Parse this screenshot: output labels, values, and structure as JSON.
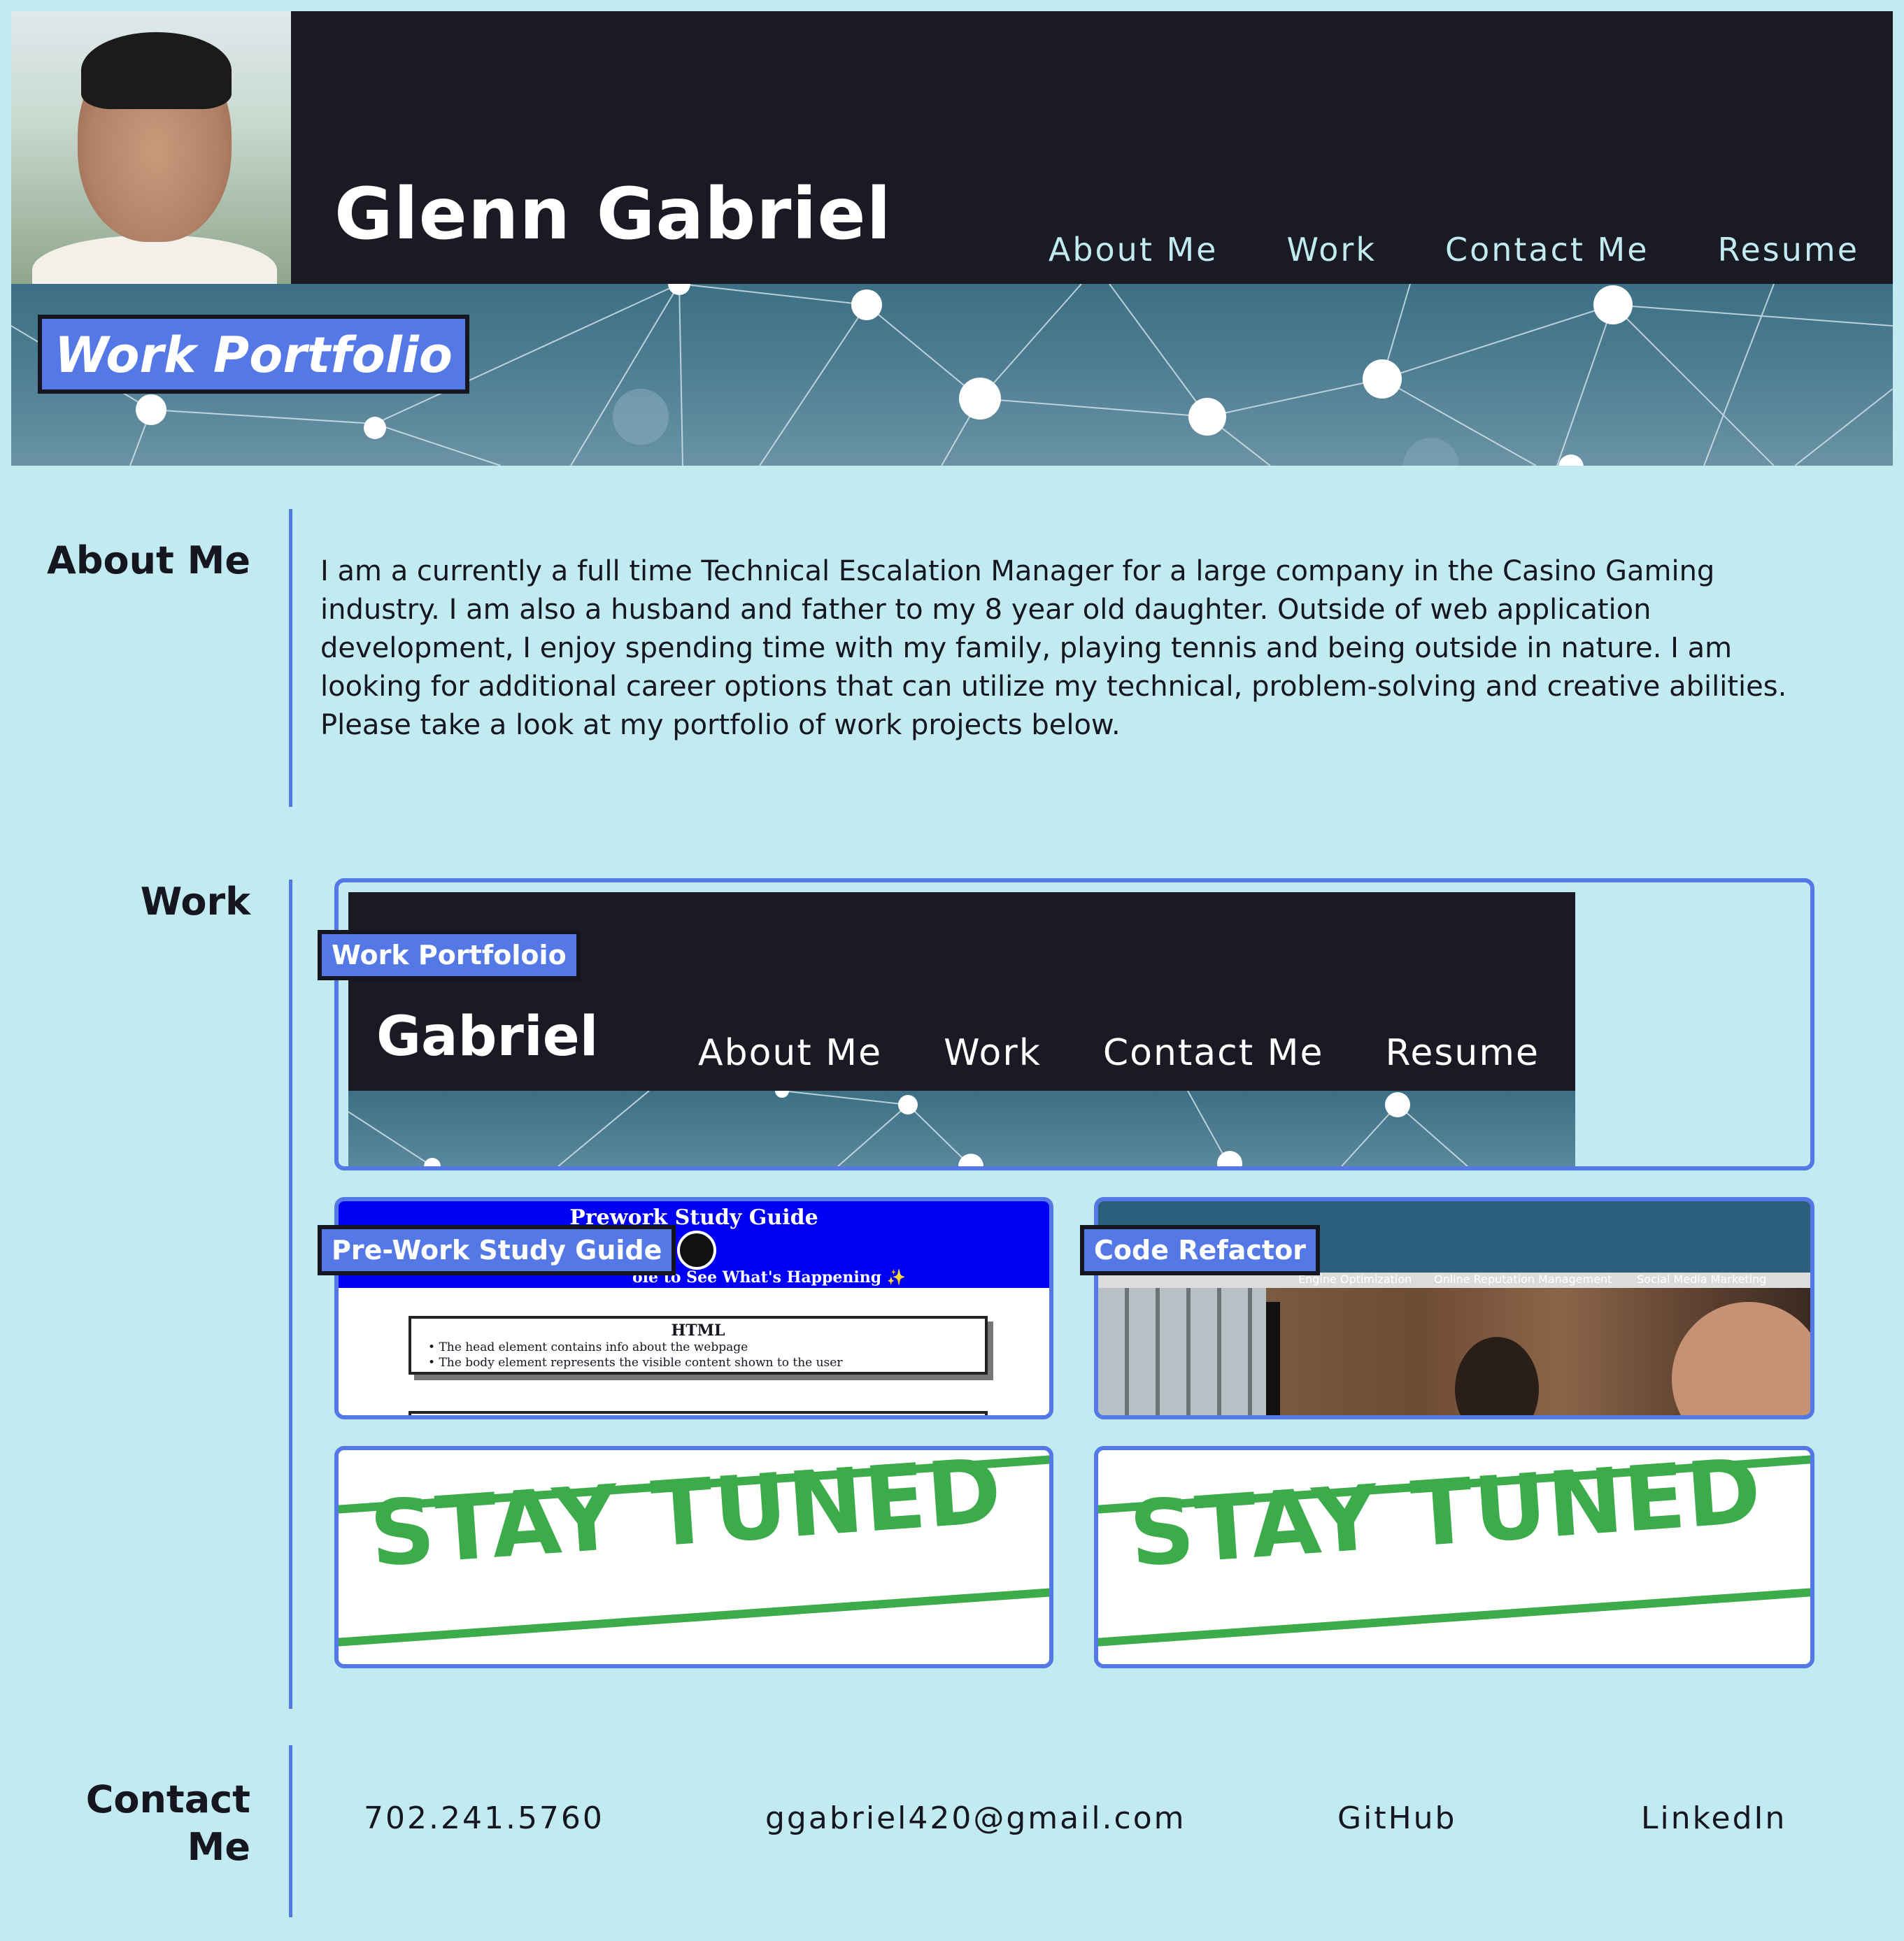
{
  "header": {
    "name": "Glenn Gabriel",
    "nav": [
      "About Me",
      "Work",
      "Contact Me",
      "Resume"
    ]
  },
  "hero": {
    "title": "Work Portfolio"
  },
  "about": {
    "label": "About Me",
    "text": "I am a currently a full time Technical Escalation Manager for a large company in the Casino Gaming industry. I am also a husband and father to my 8 year old daughter. Outside of web application development, I enjoy spending time with my family, playing tennis and being outside in nature. I am looking for additional career options that can utilize my technical, problem-solving and creative abilities. Please take a look at my portfolio of work projects below."
  },
  "work": {
    "label": "Work",
    "projects": [
      {
        "tag": "Work Portfoloio",
        "preview_name": "Gabriel",
        "preview_nav": [
          "About Me",
          "Work",
          "Contact Me",
          "Resume"
        ]
      },
      {
        "tag": "Pre-Work Study Guide",
        "preview_title": "Prework Study Guide",
        "preview_subtitle": "ole to See What's Happening ✨",
        "preview_box_heading": "HTML",
        "preview_box_items": [
          "The head element contains info about the webpage",
          "The body element represents the visible content shown to the user"
        ]
      },
      {
        "tag": "Code Refactor",
        "preview_nav": [
          "Engine Optimization",
          "Online Reputation Management",
          "Social Media Marketing"
        ]
      },
      {
        "stamp": "STAY TUNED"
      },
      {
        "stamp": "STAY TUNED"
      }
    ]
  },
  "contact": {
    "label_line1": "Contact",
    "label_line2": "Me",
    "phone": "702.241.5760",
    "email": "ggabriel420@gmail.com",
    "github": "GitHub",
    "linkedin": "LinkedIn"
  },
  "colors": {
    "page_bg": "#c1ebf0",
    "header_bg": "#191a24",
    "accent": "#5479e6",
    "stamp_green": "#3cab4a"
  }
}
